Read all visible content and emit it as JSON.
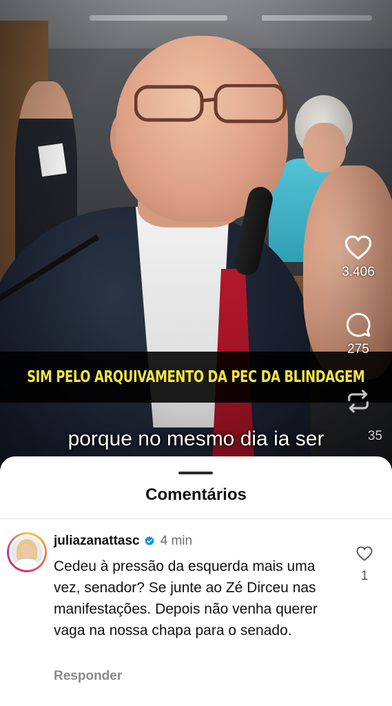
{
  "video": {
    "caption_banner": "SIM PELO ARQUIVAMENTO DA PEC DA BLINDAGEM",
    "subtitle_line": "porque no mesmo dia ia ser",
    "subtitle_partial": "· · · ·",
    "actions": {
      "likes": "3.406",
      "comments": "275",
      "reposts": "35"
    }
  },
  "comments_sheet": {
    "title": "Comentários",
    "comments": [
      {
        "username": "juliazanattasc",
        "time": "4 min",
        "text": "Cedeu à pressão da esquerda mais uma vez, senador? Se junte ao Zé Dirceu nas manifestações. Depois não venha querer vaga na nossa chapa para o senado.",
        "reply_label": "Responder",
        "likes": "1"
      }
    ]
  },
  "icons": {
    "like": "heart-icon",
    "comment": "comment-bubble-icon",
    "repost": "repost-icon",
    "verified": "verified-badge-icon"
  },
  "colors": {
    "caption_text": "#f0e443",
    "verified_blue": "#0095f6",
    "sheet_background": "#ffffff"
  }
}
